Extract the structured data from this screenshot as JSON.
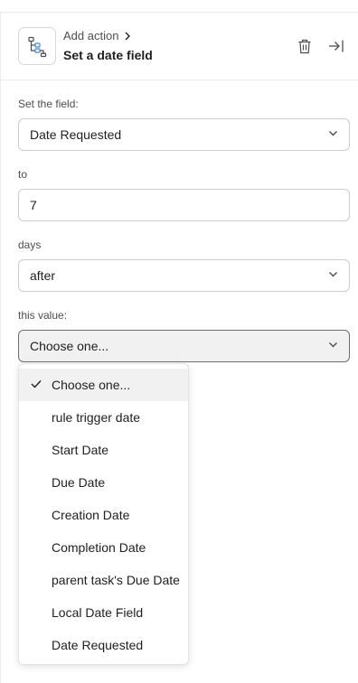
{
  "header": {
    "breadcrumb": "Add action",
    "title": "Set a date field",
    "icons": {
      "app": "workflow-tree-icon",
      "breadcrumb": "chevron-right-icon",
      "delete": "trash-icon",
      "collapse": "collapse-panel-icon"
    }
  },
  "form": {
    "set_field_label": "Set the field:",
    "set_field_value": "Date Requested",
    "to_label": "to",
    "to_value": "7",
    "days_label": "days",
    "direction_value": "after",
    "this_value_label": "this value:",
    "this_value_value": "Choose one..."
  },
  "dropdown": {
    "options": [
      {
        "label": "Choose one...",
        "selected": true
      },
      {
        "label": "rule trigger date",
        "selected": false
      },
      {
        "label": "Start Date",
        "selected": false
      },
      {
        "label": "Due Date",
        "selected": false
      },
      {
        "label": "Creation Date",
        "selected": false
      },
      {
        "label": "Completion Date",
        "selected": false
      },
      {
        "label": "parent task's Due Date",
        "selected": false
      },
      {
        "label": "Local Date Field",
        "selected": false
      },
      {
        "label": "Date Requested",
        "selected": false
      }
    ]
  },
  "colors": {
    "accent_icon": "#3f8bd6",
    "text": "#1e1f21",
    "muted": "#4c4d51",
    "border": "#cfcbcb",
    "selected_bg": "#f1f1f1"
  }
}
